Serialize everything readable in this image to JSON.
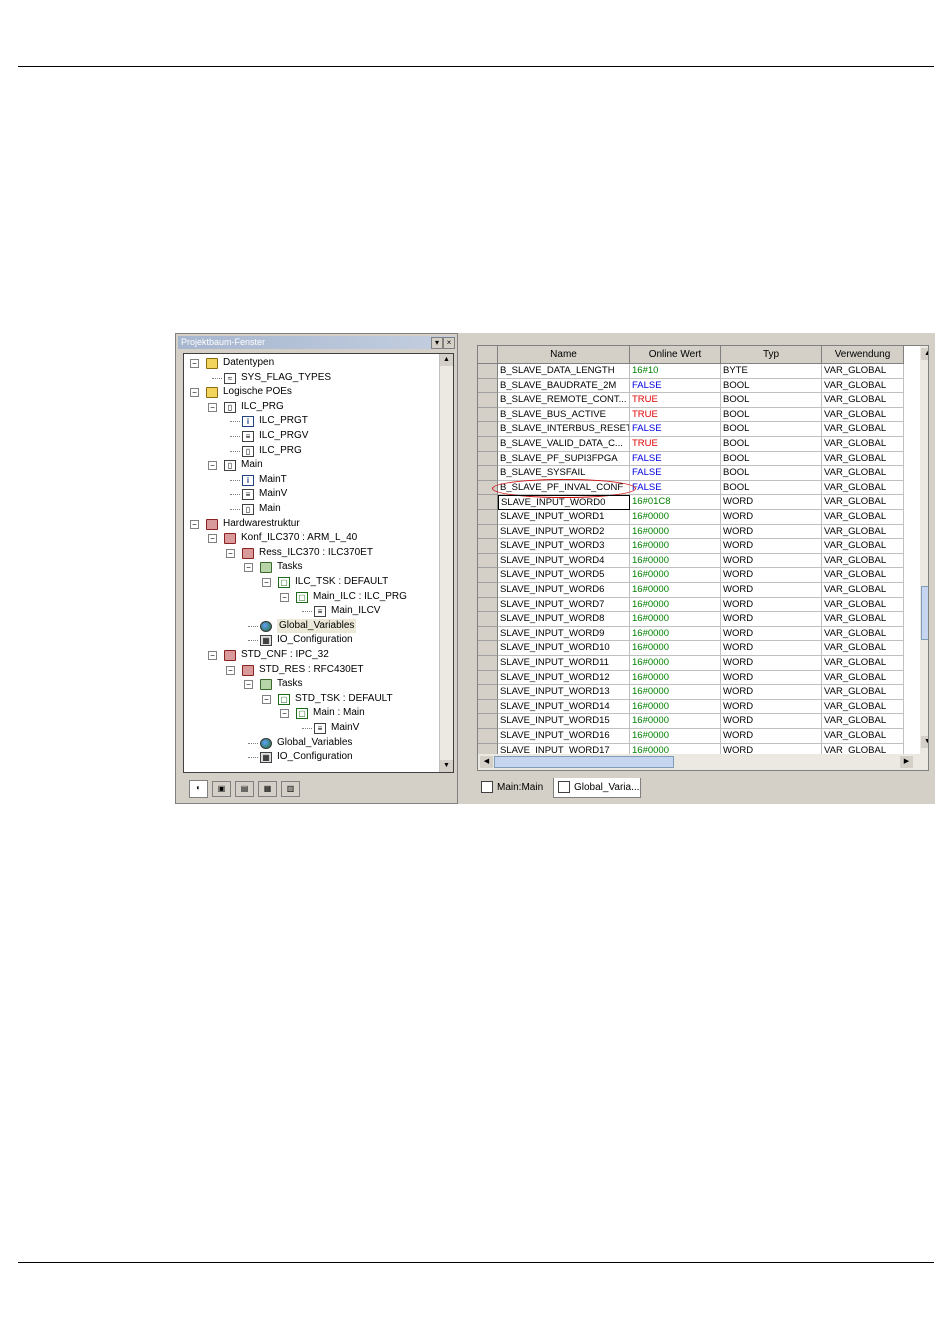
{
  "tree_panel": {
    "title": "Projektbaum-Fenster",
    "buttons": [
      "▾",
      "×"
    ],
    "nodes": [
      {
        "label": "Datentypen",
        "icon": "folder-icon",
        "toggle": "⊟"
      },
      {
        "label": "SYS_FLAG_TYPES",
        "icon": "struct-icon"
      },
      {
        "label": "Logische POEs",
        "icon": "folder-icon",
        "toggle": "⊟"
      },
      {
        "label": "ILC_PRG",
        "icon": "program-icon",
        "toggle": "⊟"
      },
      {
        "label": "ILC_PRGT",
        "icon": "info-icon"
      },
      {
        "label": "ILC_PRGV",
        "icon": "var-list-icon"
      },
      {
        "label": "ILC_PRG",
        "icon": "code-icon"
      },
      {
        "label": "Main",
        "icon": "program-icon",
        "toggle": "⊟"
      },
      {
        "label": "MainT",
        "icon": "info-icon"
      },
      {
        "label": "MainV",
        "icon": "var-list-icon"
      },
      {
        "label": "Main",
        "icon": "code-icon"
      },
      {
        "label": "Hardwarestruktur",
        "icon": "hardware-folder-icon",
        "toggle": "⊟"
      },
      {
        "label": "Konf_ILC370 : ARM_L_40",
        "icon": "config-icon",
        "toggle": "⊟"
      },
      {
        "label": "Ress_ILC370 : ILC370ET",
        "icon": "resource-icon",
        "toggle": "⊟"
      },
      {
        "label": "Tasks",
        "icon": "tasks-folder-icon",
        "toggle": "⊟"
      },
      {
        "label": "ILC_TSK : DEFAULT",
        "icon": "task-icon",
        "toggle": "⊟"
      },
      {
        "label": "Main_ILC : ILC_PRG",
        "icon": "task-icon",
        "toggle": "⊟"
      },
      {
        "label": "Main_ILCV",
        "icon": "var-list-icon"
      },
      {
        "label": "Global_Variables",
        "icon": "globe-icon",
        "selected": true
      },
      {
        "label": "IO_Configuration",
        "icon": "io-icon"
      },
      {
        "label": "STD_CNF : IPC_32",
        "icon": "config-icon",
        "toggle": "⊟"
      },
      {
        "label": "STD_RES : RFC430ET",
        "icon": "resource-icon",
        "toggle": "⊟"
      },
      {
        "label": "Tasks",
        "icon": "tasks-folder-icon",
        "toggle": "⊟"
      },
      {
        "label": "STD_TSK : DEFAULT",
        "icon": "task-icon",
        "toggle": "⊟"
      },
      {
        "label": "Main : Main",
        "icon": "task-icon",
        "toggle": "⊟"
      },
      {
        "label": "MainV",
        "icon": "var-list-icon"
      },
      {
        "label": "Global_Variables",
        "icon": "globe-icon"
      },
      {
        "label": "IO_Configuration",
        "icon": "io-icon"
      }
    ],
    "bottom_tabs": [
      "project-tree-tab-icon",
      "libraries-tab-icon",
      "instances-tab-icon",
      "hardware-tab-icon",
      "io-tab-icon"
    ]
  },
  "grid": {
    "columns": [
      "Name",
      "Online Wert",
      "Typ",
      "Verwendung"
    ],
    "rows": [
      {
        "name": "B_SLAVE_DATA_LENGTH",
        "value": "16#10",
        "color": "green",
        "type": "BYTE",
        "usage": "VAR_GLOBAL"
      },
      {
        "name": "B_SLAVE_BAUDRATE_2M",
        "value": "FALSE",
        "color": "blue",
        "type": "BOOL",
        "usage": "VAR_GLOBAL"
      },
      {
        "name": "B_SLAVE_REMOTE_CONT...",
        "value": "TRUE",
        "color": "red",
        "type": "BOOL",
        "usage": "VAR_GLOBAL"
      },
      {
        "name": "B_SLAVE_BUS_ACTIVE",
        "value": "TRUE",
        "color": "red",
        "type": "BOOL",
        "usage": "VAR_GLOBAL"
      },
      {
        "name": "B_SLAVE_INTERBUS_RESET",
        "value": "FALSE",
        "color": "blue",
        "type": "BOOL",
        "usage": "VAR_GLOBAL"
      },
      {
        "name": "B_SLAVE_VALID_DATA_C...",
        "value": "TRUE",
        "color": "red",
        "type": "BOOL",
        "usage": "VAR_GLOBAL"
      },
      {
        "name": "B_SLAVE_PF_SUPI3FPGA",
        "value": "FALSE",
        "color": "blue",
        "type": "BOOL",
        "usage": "VAR_GLOBAL"
      },
      {
        "name": "B_SLAVE_SYSFAIL",
        "value": "FALSE",
        "color": "blue",
        "type": "BOOL",
        "usage": "VAR_GLOBAL"
      },
      {
        "name": "B_SLAVE_PF_INVAL_CONF",
        "value": "FALSE",
        "color": "blue",
        "type": "BOOL",
        "usage": "VAR_GLOBAL"
      },
      {
        "name": "SLAVE_INPUT_WORD0",
        "value": "16#01C8",
        "color": "green",
        "type": "WORD",
        "usage": "VAR_GLOBAL"
      },
      {
        "name": "SLAVE_INPUT_WORD1",
        "value": "16#0000",
        "color": "green",
        "type": "WORD",
        "usage": "VAR_GLOBAL"
      },
      {
        "name": "SLAVE_INPUT_WORD2",
        "value": "16#0000",
        "color": "green",
        "type": "WORD",
        "usage": "VAR_GLOBAL"
      },
      {
        "name": "SLAVE_INPUT_WORD3",
        "value": "16#0000",
        "color": "green",
        "type": "WORD",
        "usage": "VAR_GLOBAL"
      },
      {
        "name": "SLAVE_INPUT_WORD4",
        "value": "16#0000",
        "color": "green",
        "type": "WORD",
        "usage": "VAR_GLOBAL"
      },
      {
        "name": "SLAVE_INPUT_WORD5",
        "value": "16#0000",
        "color": "green",
        "type": "WORD",
        "usage": "VAR_GLOBAL"
      },
      {
        "name": "SLAVE_INPUT_WORD6",
        "value": "16#0000",
        "color": "green",
        "type": "WORD",
        "usage": "VAR_GLOBAL"
      },
      {
        "name": "SLAVE_INPUT_WORD7",
        "value": "16#0000",
        "color": "green",
        "type": "WORD",
        "usage": "VAR_GLOBAL"
      },
      {
        "name": "SLAVE_INPUT_WORD8",
        "value": "16#0000",
        "color": "green",
        "type": "WORD",
        "usage": "VAR_GLOBAL"
      },
      {
        "name": "SLAVE_INPUT_WORD9",
        "value": "16#0000",
        "color": "green",
        "type": "WORD",
        "usage": "VAR_GLOBAL"
      },
      {
        "name": "SLAVE_INPUT_WORD10",
        "value": "16#0000",
        "color": "green",
        "type": "WORD",
        "usage": "VAR_GLOBAL"
      },
      {
        "name": "SLAVE_INPUT_WORD11",
        "value": "16#0000",
        "color": "green",
        "type": "WORD",
        "usage": "VAR_GLOBAL"
      },
      {
        "name": "SLAVE_INPUT_WORD12",
        "value": "16#0000",
        "color": "green",
        "type": "WORD",
        "usage": "VAR_GLOBAL"
      },
      {
        "name": "SLAVE_INPUT_WORD13",
        "value": "16#0000",
        "color": "green",
        "type": "WORD",
        "usage": "VAR_GLOBAL"
      },
      {
        "name": "SLAVE_INPUT_WORD14",
        "value": "16#0000",
        "color": "green",
        "type": "WORD",
        "usage": "VAR_GLOBAL"
      },
      {
        "name": "SLAVE_INPUT_WORD15",
        "value": "16#0000",
        "color": "green",
        "type": "WORD",
        "usage": "VAR_GLOBAL"
      },
      {
        "name": "SLAVE_INPUT_WORD16",
        "value": "16#0000",
        "color": "green",
        "type": "WORD",
        "usage": "VAR_GLOBAL"
      },
      {
        "name": "SLAVE_INPUT_WORD17",
        "value": "16#0000",
        "color": "green",
        "type": "WORD",
        "usage": "VAR_GLOBAL"
      }
    ],
    "highlighted_row": "B_SLAVE_PF_INVAL_CONF",
    "colors": {
      "green": "#008000",
      "red": "#e00000",
      "blue": "#0000e0",
      "highlight_circle": "#d01010"
    }
  },
  "doc_tabs": [
    {
      "label": "Main:Main",
      "icon": "code-tab-icon",
      "active": false
    },
    {
      "label": "Global_Varia...",
      "icon": "var-list-tab-icon",
      "active": true
    }
  ]
}
